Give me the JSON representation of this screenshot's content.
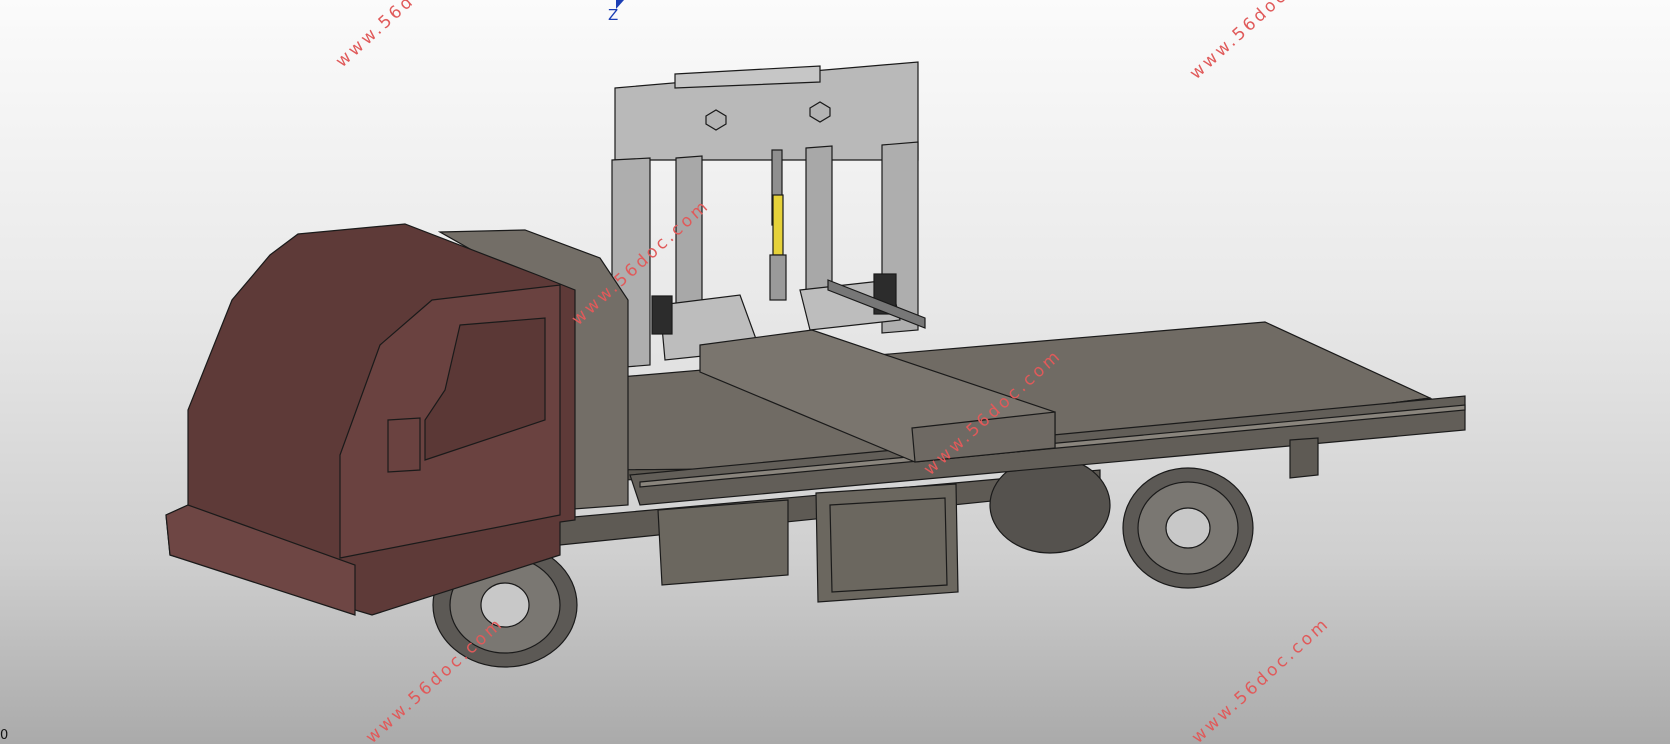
{
  "viewport": {
    "model": "flatbed-truck-with-lifting-frame",
    "background_colors": [
      "#fbfbfb",
      "#e9e9e9",
      "#aaaaaa"
    ],
    "colors": {
      "cab": "#5e3a38",
      "body": "#6f6a63",
      "frame": "#b9b9b9",
      "cylinder": "#e6d23a",
      "watermark": "#e05a5a"
    }
  },
  "triad": {
    "axis_label": "Z",
    "icon": "triad-arrow-icon"
  },
  "watermarks": [
    "www.56doc.com",
    "www.56doc.com",
    "www.56doc.com",
    "www.56doc.com",
    "www.56doc.com",
    "www.56doc.com"
  ],
  "corner_text": "0"
}
